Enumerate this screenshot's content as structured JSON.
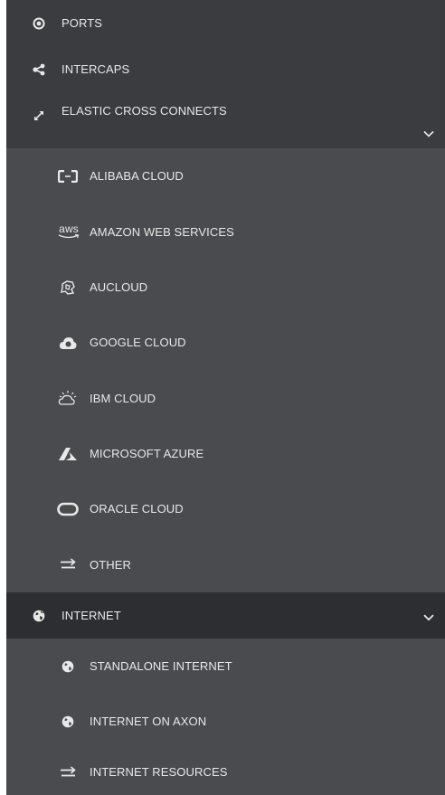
{
  "nav": {
    "top_items": [
      {
        "label": "PORTS",
        "icon": "radio-circle-icon"
      },
      {
        "label": "INTERCAPS",
        "icon": "share-nodes-icon"
      },
      {
        "label": "ELASTIC CROSS CONNECTS",
        "icon": "diagonal-arrows-icon",
        "expanded": true
      }
    ],
    "ecc_items": [
      {
        "label": "ALIBABA CLOUD",
        "icon": "alibaba-icon"
      },
      {
        "label": "AMAZON WEB SERVICES",
        "icon": "aws-icon",
        "icon_text": "aws"
      },
      {
        "label": "AUCLOUD",
        "icon": "aucloud-icon"
      },
      {
        "label": "GOOGLE CLOUD",
        "icon": "google-cloud-icon"
      },
      {
        "label": "IBM CLOUD",
        "icon": "ibm-cloud-icon"
      },
      {
        "label": "MICROSOFT AZURE",
        "icon": "azure-icon"
      },
      {
        "label": "ORACLE CLOUD",
        "icon": "oracle-icon"
      },
      {
        "label": "OTHER",
        "icon": "transfer-arrows-icon"
      }
    ],
    "internet": {
      "label": "INTERNET",
      "icon": "globe-icon",
      "expanded": true,
      "active": true
    },
    "internet_items": [
      {
        "label": "STANDALONE INTERNET",
        "icon": "globe-icon"
      },
      {
        "label": "INTERNET ON AXON",
        "icon": "globe-icon"
      },
      {
        "label": "INTERNET RESOURCES",
        "icon": "transfer-arrows-icon"
      }
    ]
  },
  "colors": {
    "sidebar_bg": "#3b3c40",
    "submenu_bg": "#4a4b4f",
    "active_bg": "#2d2e31",
    "accent": "#e0312b",
    "text": "#e8e8e8"
  }
}
